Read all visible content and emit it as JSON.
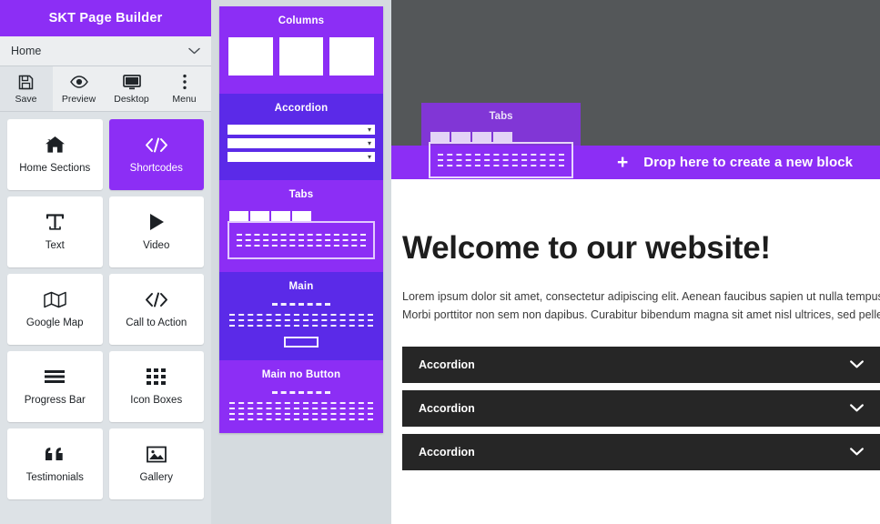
{
  "sidebar": {
    "title": "SKT Page Builder",
    "page_selector": {
      "value": "Home",
      "chevron_icon": "chevron-down-icon"
    },
    "toolbar": [
      {
        "label": "Save",
        "icon": "save-icon",
        "active": true
      },
      {
        "label": "Preview",
        "icon": "eye-icon",
        "active": false
      },
      {
        "label": "Desktop",
        "icon": "monitor-icon",
        "active": false
      },
      {
        "label": "Menu",
        "icon": "kebab-menu-icon",
        "active": false
      }
    ],
    "widgets": [
      {
        "label": "Home Sections",
        "icon": "home-icon",
        "selected": false
      },
      {
        "label": "Shortcodes",
        "icon": "code-icon",
        "selected": true
      },
      {
        "label": "Text",
        "icon": "text-icon",
        "selected": false
      },
      {
        "label": "Video",
        "icon": "play-icon",
        "selected": false
      },
      {
        "label": "Google Map",
        "icon": "map-icon",
        "selected": false
      },
      {
        "label": "Call to Action",
        "icon": "code-icon",
        "selected": false
      },
      {
        "label": "Progress Bar",
        "icon": "bars-icon",
        "selected": false
      },
      {
        "label": "Icon Boxes",
        "icon": "grid-dots-icon",
        "selected": false
      },
      {
        "label": "Testimonials",
        "icon": "quote-icon",
        "selected": false
      },
      {
        "label": "Gallery",
        "icon": "image-icon",
        "selected": false
      }
    ]
  },
  "blocks_panel": {
    "items": [
      {
        "title": "Columns",
        "shade": "light"
      },
      {
        "title": "Accordion",
        "shade": "deep"
      },
      {
        "title": "Tabs",
        "shade": "light"
      },
      {
        "title": "Main",
        "shade": "deep"
      },
      {
        "title": "Main no Button",
        "shade": "light"
      }
    ]
  },
  "canvas": {
    "drop_zone": {
      "label": "Drop here to create a new block",
      "plus_icon": "plus-icon"
    },
    "dragged_block": {
      "title": "Tabs"
    },
    "page": {
      "heading": "Welcome to our website!",
      "paragraph_line_1": "Lorem ipsum dolor sit amet, consectetur adipiscing elit. Aenean faucibus sapien ut nulla tempus, vel commod",
      "paragraph_line_2": "Morbi porttitor non sem non dapibus. Curabitur bibendum magna sit amet nisl ultrices, sed pellentesque mag",
      "accordions": [
        {
          "label": "Accordion",
          "chevron_icon": "chevron-down-icon"
        },
        {
          "label": "Accordion",
          "chevron_icon": "chevron-down-icon"
        },
        {
          "label": "Accordion",
          "chevron_icon": "chevron-down-icon"
        }
      ]
    }
  },
  "colors": {
    "brand_purple": "#8c2ef5",
    "deep_purple": "#5b2ae8",
    "canvas_gray": "#545759",
    "accordion_dark": "#262626"
  }
}
